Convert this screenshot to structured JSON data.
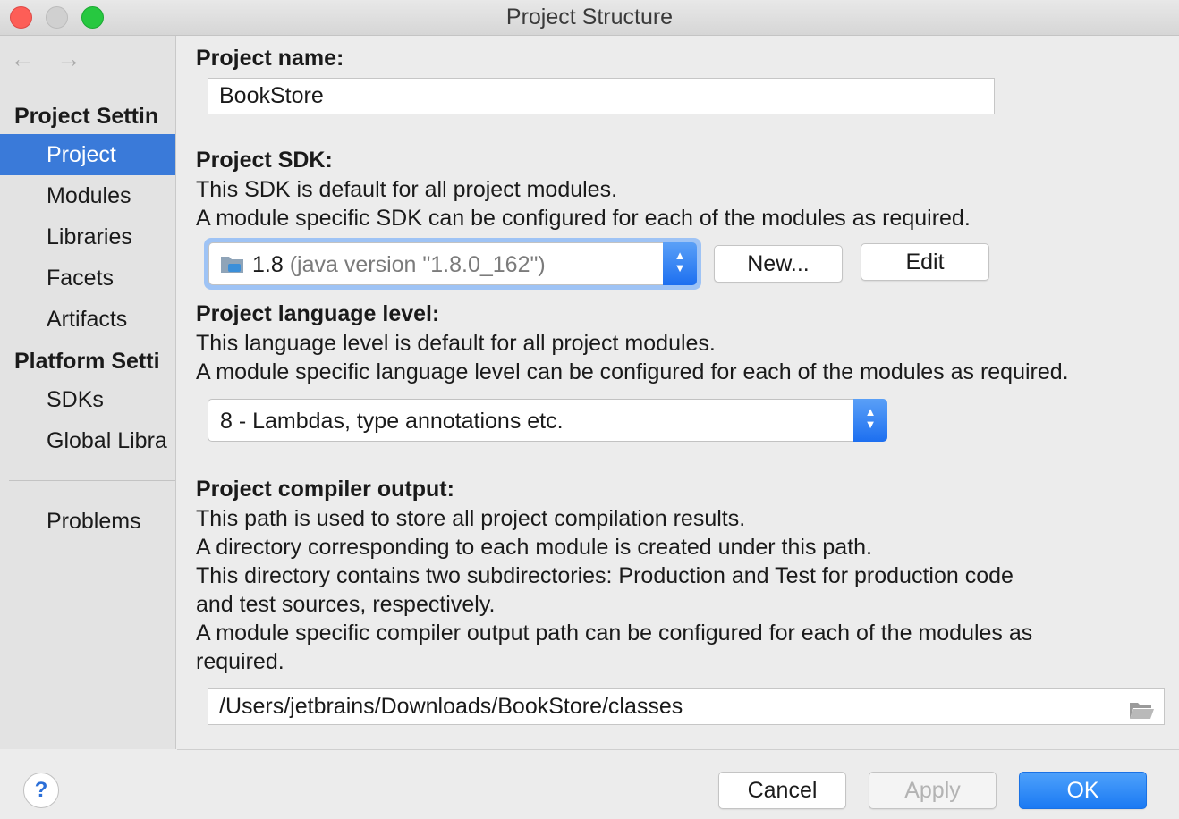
{
  "window": {
    "title": "Project Structure"
  },
  "sidebar": {
    "project_settings_header": "Project Settin",
    "project_items": [
      "Project",
      "Modules",
      "Libraries",
      "Facets",
      "Artifacts"
    ],
    "platform_settings_header": "Platform Setti",
    "platform_items": [
      "SDKs",
      "Global Libra"
    ],
    "problems": "Problems",
    "selected": "Project"
  },
  "content": {
    "project_name_label": "Project name:",
    "project_name_value": "BookStore",
    "sdk_label": "Project SDK:",
    "sdk_desc_1": "This SDK is default for all project modules.",
    "sdk_desc_2": "A module specific SDK can be configured for each of the modules as required.",
    "sdk_selected_version": "1.8",
    "sdk_selected_detail": "(java version \"1.8.0_162\")",
    "sdk_new_button": "New...",
    "sdk_edit_button": "Edit",
    "lang_label": "Project language level:",
    "lang_desc_1": "This language level is default for all project modules.",
    "lang_desc_2": "A module specific language level can be configured for each of the modules as required.",
    "lang_selected": "8 - Lambdas, type annotations etc.",
    "output_label": "Project compiler output:",
    "output_desc_1": "This path is used to store all project compilation results.",
    "output_desc_2": "A directory corresponding to each module is created under this path.",
    "output_desc_3": "This directory contains two subdirectories: Production and Test for production code",
    "output_desc_4": "and test sources, respectively.",
    "output_desc_5": "A module specific compiler output path can be configured for each of the modules as",
    "output_desc_6": "required.",
    "output_path": "/Users/jetbrains/Downloads/BookStore/classes"
  },
  "footer": {
    "help": "?",
    "cancel": "Cancel",
    "apply": "Apply",
    "ok": "OK"
  },
  "colors": {
    "selection": "#3a7ad9",
    "primary_button": "#1b7af3",
    "close": "#fd5e57",
    "maximize": "#27c840"
  }
}
